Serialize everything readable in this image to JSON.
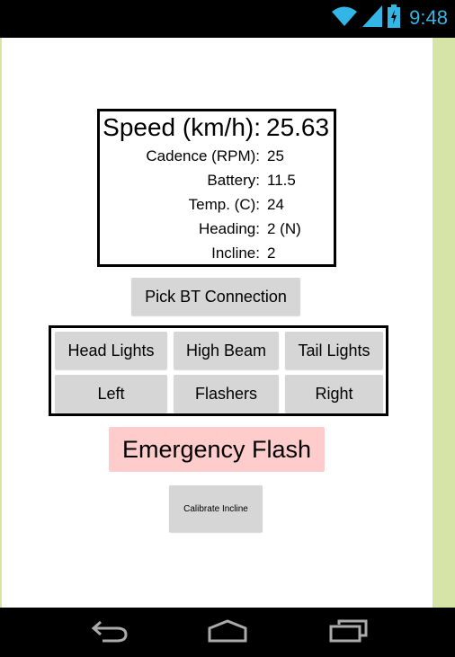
{
  "status_bar": {
    "time": "9:48",
    "icons": [
      "wifi-icon",
      "cell-signal-icon",
      "battery-charging-icon"
    ],
    "accent_color": "#33b5e5"
  },
  "readouts": {
    "speed": {
      "label": "Speed (km/h):",
      "value": "25.63"
    },
    "cadence": {
      "label": "Cadence (RPM):",
      "value": "25"
    },
    "battery": {
      "label": "Battery:",
      "value": "11.5"
    },
    "temp": {
      "label": "Temp. (C):",
      "value": "24"
    },
    "heading": {
      "label": "Heading:",
      "value": "2 (N)"
    },
    "incline": {
      "label": "Incline:",
      "value": "2"
    }
  },
  "buttons": {
    "pick_bt": "Pick BT Connection",
    "head_lights": "Head Lights",
    "high_beam": "High Beam",
    "tail_lights": "Tail Lights",
    "left": "Left",
    "flashers": "Flashers",
    "right": "Right",
    "emergency": "Emergency Flash",
    "calibrate": "Calibrate Incline"
  },
  "colors": {
    "button_gray": "#d6d6d6",
    "emergency_pink": "#ffcccc",
    "side_panel_green": "#d6e4a8"
  },
  "nav_bar": {
    "icons": [
      "back-icon",
      "home-icon",
      "recent-apps-icon"
    ]
  }
}
